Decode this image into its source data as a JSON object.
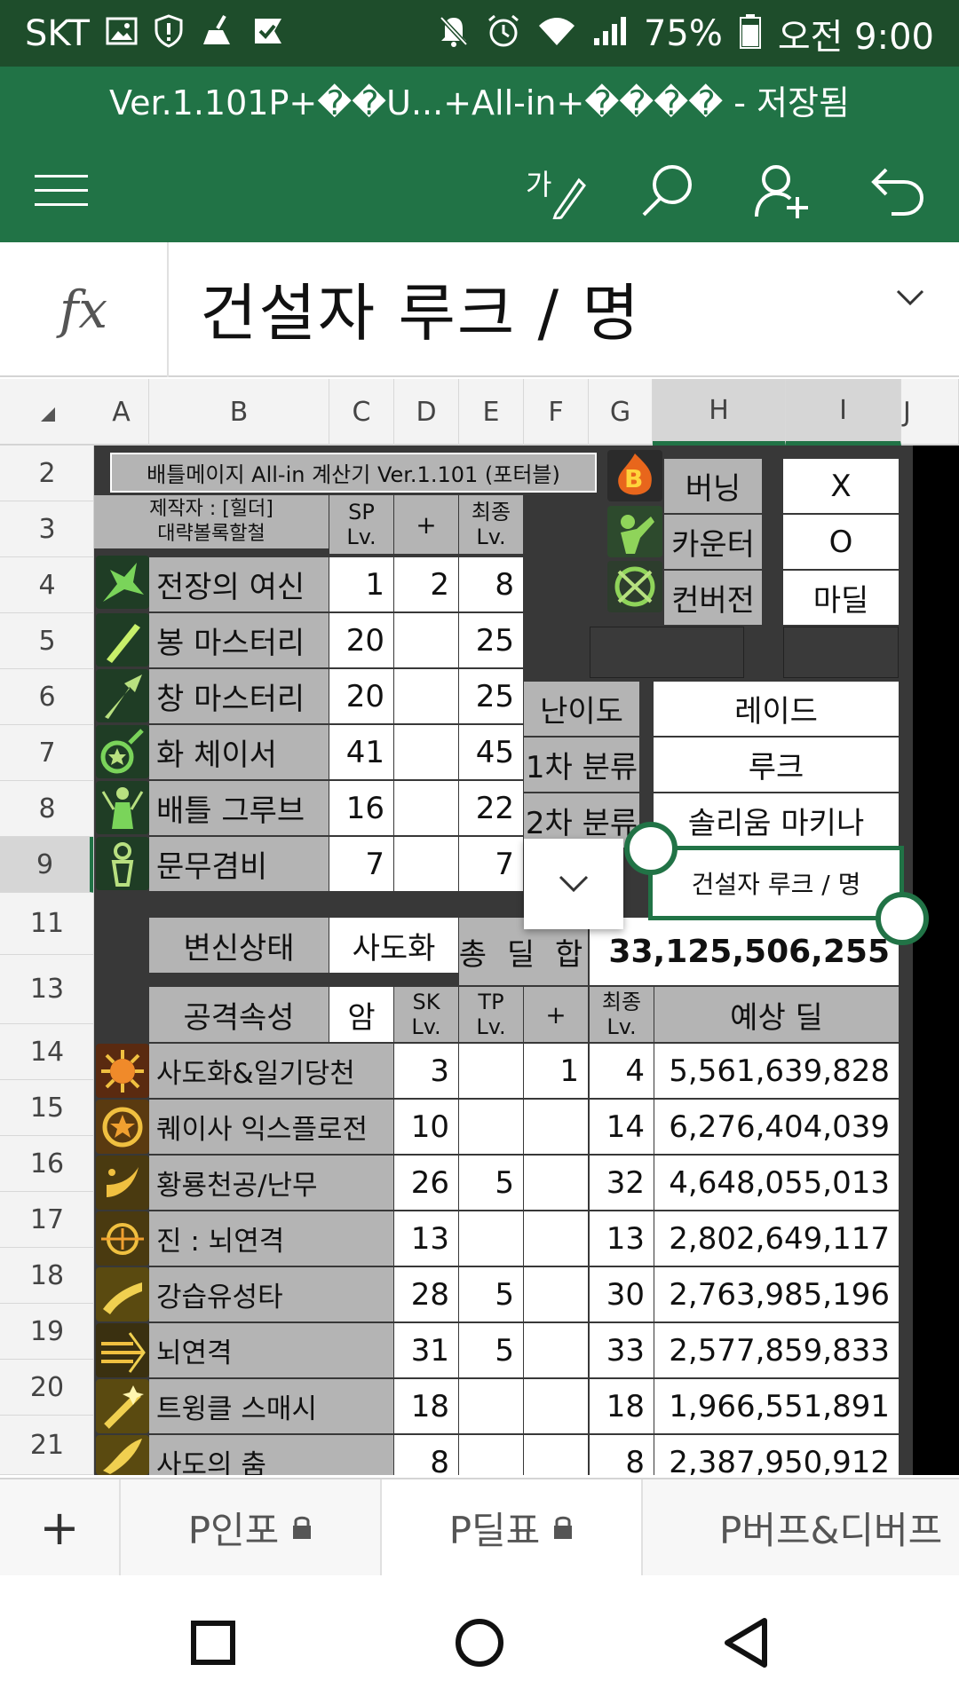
{
  "status_bar": {
    "carrier": "SKT",
    "battery": "75%",
    "time": "오전 9:00"
  },
  "title_bar": {
    "document_title": "Ver.1.101P+��U...+All-in+���� - 저장됨"
  },
  "formula_bar": {
    "fx_label": "fx",
    "content": "건설자 루크 / 명"
  },
  "column_headers": [
    "A",
    "B",
    "C",
    "D",
    "E",
    "F",
    "G",
    "H",
    "I",
    "J"
  ],
  "row_headers": [
    "2",
    "3",
    "4",
    "5",
    "6",
    "7",
    "8",
    "9",
    "11",
    "13",
    "14",
    "15",
    "16",
    "17",
    "18",
    "19",
    "20",
    "21"
  ],
  "sheet": {
    "title_banner": "배틀메이지 All-in 계산기 Ver.1.101 (포터블)",
    "author_line1": "제작자 : [힐더]",
    "author_line2": "대략볼록할철",
    "hdr_sp": "SP\nLv.",
    "hdr_plus": "+",
    "hdr_final": "최종\nLv.",
    "skills_top": [
      {
        "name": "전장의 여신",
        "sp": "1",
        "plus": "2",
        "final": "8"
      },
      {
        "name": "봉 마스터리",
        "sp": "20",
        "plus": "",
        "final": "25"
      },
      {
        "name": "창 마스터리",
        "sp": "20",
        "plus": "",
        "final": "25"
      },
      {
        "name": "화 체이서",
        "sp": "41",
        "plus": "",
        "final": "45"
      },
      {
        "name": "배틀 그루브",
        "sp": "16",
        "plus": "",
        "final": "22"
      },
      {
        "name": "문무겸비",
        "sp": "7",
        "plus": "",
        "final": "7"
      }
    ],
    "options": [
      {
        "label": "버닝",
        "value": "X"
      },
      {
        "label": "카운터",
        "value": "O"
      },
      {
        "label": "컨버전",
        "value": "마딜"
      }
    ],
    "difficulty_label": "난이도",
    "difficulty_value": "레이드",
    "class1_label": "1차 분류",
    "class1_value": "루크",
    "class2_label": "2차 분류",
    "class2_value": "솔리움 마키나",
    "row9_selected_value": "건설자 루크 / 명",
    "transform_label": "변신상태",
    "transform_value": "사도화",
    "total_label": "총 딜 합",
    "total_value": "33,125,506,255",
    "attack_attr_label": "공격속성",
    "attack_attr_value": "암",
    "hdr_sk": "SK\nLv.",
    "hdr_tp": "TP\nLv.",
    "hdr_plus2": "+",
    "hdr_final2": "최종\nLv.",
    "hdr_expected": "예상 딜",
    "skills_bottom": [
      {
        "name": "사도화&일기당천",
        "sk": "3",
        "tp": "",
        "plus": "1",
        "final": "4",
        "damage": "5,561,639,828"
      },
      {
        "name": "퀘이사 익스플로전",
        "sk": "10",
        "tp": "",
        "plus": "",
        "final": "14",
        "damage": "6,276,404,039"
      },
      {
        "name": "황룡천공/난무",
        "sk": "26",
        "tp": "5",
        "plus": "",
        "final": "32",
        "damage": "4,648,055,013"
      },
      {
        "name": "진 : 뇌연격",
        "sk": "13",
        "tp": "",
        "plus": "",
        "final": "13",
        "damage": "2,802,649,117"
      },
      {
        "name": "강습유성타",
        "sk": "28",
        "tp": "5",
        "plus": "",
        "final": "30",
        "damage": "2,763,985,196"
      },
      {
        "name": "뇌연격",
        "sk": "31",
        "tp": "5",
        "plus": "",
        "final": "33",
        "damage": "2,577,859,833"
      },
      {
        "name": "트윙클 스매시",
        "sk": "18",
        "tp": "",
        "plus": "",
        "final": "18",
        "damage": "1,966,551,891"
      },
      {
        "name": "사도의 춤",
        "sk": "8",
        "tp": "",
        "plus": "",
        "final": "8",
        "damage": "2,387,950,912"
      }
    ]
  },
  "sheet_tabs": {
    "add_label": "+",
    "tabs": [
      "P인포",
      "P딜표",
      "P버프&디버프"
    ]
  },
  "colors": {
    "excel_green": "#217346",
    "status_green": "#1e4d2b",
    "cell_gray": "#b4b4b4",
    "dark_fill": "#3a3a3a"
  }
}
